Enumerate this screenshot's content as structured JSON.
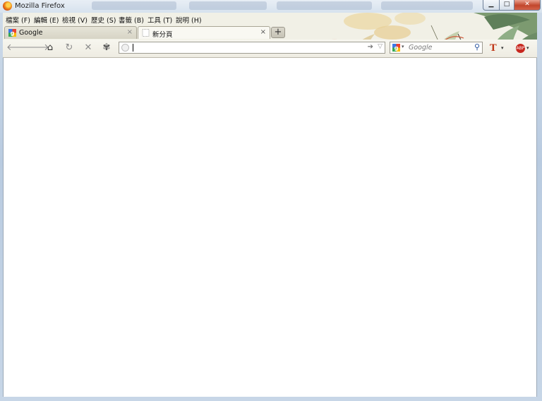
{
  "window": {
    "title": "Mozilla Firefox"
  },
  "window_buttons": {
    "minimize": "▁",
    "maximize": "□",
    "close": "✕"
  },
  "menubar": [
    "檔案 (F)",
    "編輯 (E)",
    "檢視 (V)",
    "歷史 (S)",
    "書籤 (B)",
    "工具 (T)",
    "說明 (H)"
  ],
  "tabs": [
    {
      "label": "Google",
      "icon": "google-favicon",
      "active": false
    },
    {
      "label": "新分頁",
      "icon": "blank-page-icon",
      "active": true
    }
  ],
  "new_tab_label": "+",
  "navbar": {
    "back": "back-arrow-icon",
    "forward": "forward-arrow-icon",
    "home": "home-icon",
    "reload": "reload-icon",
    "stop": "stop-icon",
    "addon": "puzzle-icon"
  },
  "urlbar": {
    "value": "",
    "placeholder": ""
  },
  "searchbar": {
    "placeholder": "Google",
    "engine": "google-favicon"
  },
  "colors": {
    "addon_red": "#c0391b",
    "window_frame": "#b9cbe0",
    "toolbar_bg": "#f1f0e6"
  }
}
